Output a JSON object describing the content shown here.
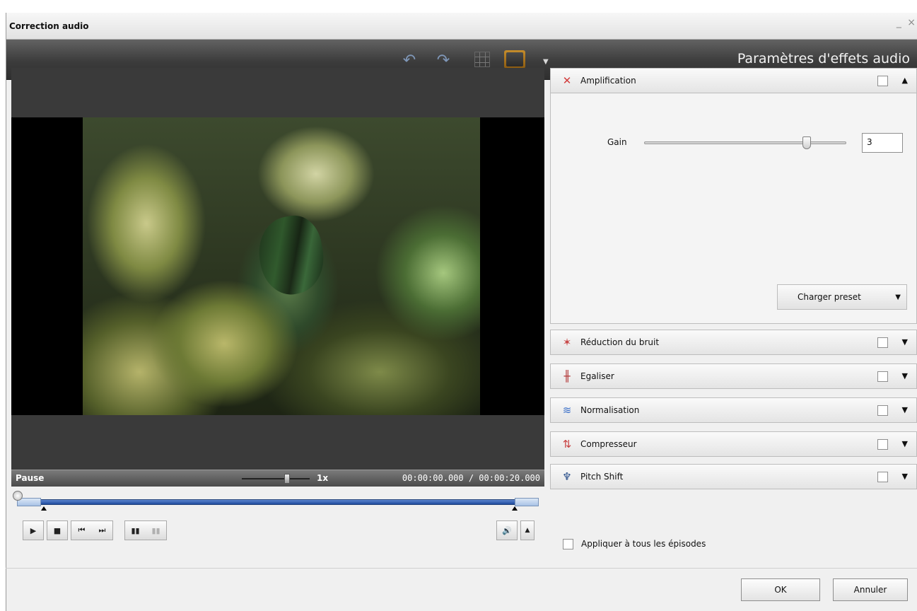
{
  "window": {
    "title": "Correction audio",
    "controls": "_ ×"
  },
  "toolbar": {
    "title": "Paramètres d'effets audio",
    "undo_icon": "undo-icon",
    "redo_icon": "redo-icon",
    "grid_icon": "grid-icon",
    "monitor_icon": "monitor-icon"
  },
  "player": {
    "status": "Pause",
    "speed": "1x",
    "time": "00:00:00.000 / 00:00:20.000"
  },
  "effects": {
    "amplification": {
      "label": "Amplification",
      "expanded": true,
      "checked": false
    },
    "gain": {
      "label": "Gain",
      "value": "3",
      "level": 0.82
    },
    "preset_button": "Charger preset",
    "sections": [
      {
        "label": "Réduction du bruit",
        "icon": "noise-reduction-icon"
      },
      {
        "label": "Egaliser",
        "icon": "equalizer-icon"
      },
      {
        "label": "Normalisation",
        "icon": "normalization-icon"
      },
      {
        "label": "Compresseur",
        "icon": "compressor-icon"
      },
      {
        "label": "Pitch Shift",
        "icon": "pitch-shift-icon"
      }
    ]
  },
  "apply_all": {
    "label": "Appliquer à tous les épisodes",
    "checked": false
  },
  "buttons": {
    "ok": "OK",
    "cancel": "Annuler"
  }
}
